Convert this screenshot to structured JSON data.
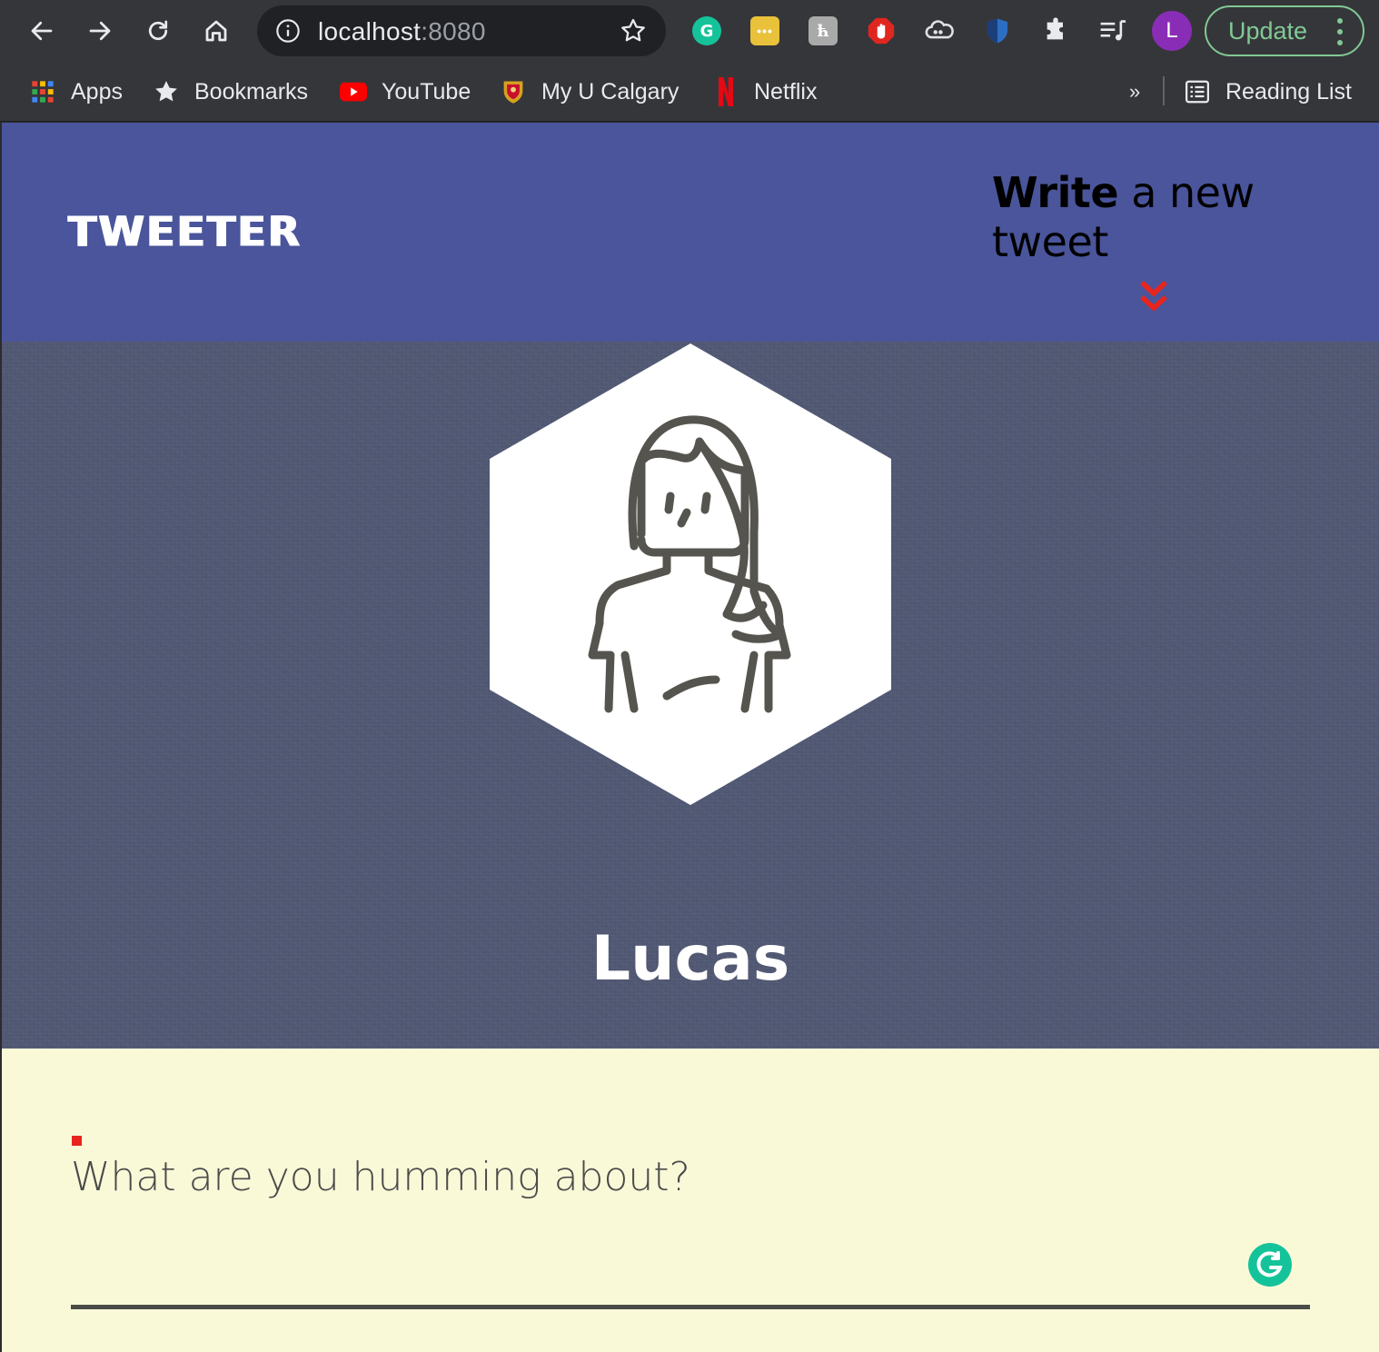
{
  "browser": {
    "address": {
      "host": "localhost",
      "port": ":8080"
    },
    "profile_initial": "L",
    "update_label": "Update",
    "bookmarks": [
      {
        "label": "Apps",
        "icon": "apps-grid-icon"
      },
      {
        "label": "Bookmarks",
        "icon": "star-icon"
      },
      {
        "label": "YouTube",
        "icon": "youtube-icon"
      },
      {
        "label": "My U Calgary",
        "icon": "ucalgary-crest-icon"
      },
      {
        "label": "Netflix",
        "icon": "netflix-icon"
      }
    ],
    "more_label": "»",
    "reading_list_label": "Reading List"
  },
  "header": {
    "logo": "TWEETER",
    "compose_toggle": {
      "strong": "Write",
      "rest": " a new tweet"
    }
  },
  "profile": {
    "name": "Lucas",
    "avatar": "woman-avatar-icon"
  },
  "compose": {
    "placeholder": "What are you humming about?",
    "value": ""
  },
  "colors": {
    "header_bg": "#4a559b",
    "banner_bg": "#515873",
    "compose_bg": "#f9f9d8",
    "accent_red": "#e8251c",
    "update_green": "#81c995",
    "grammarly": "#15c39a"
  }
}
